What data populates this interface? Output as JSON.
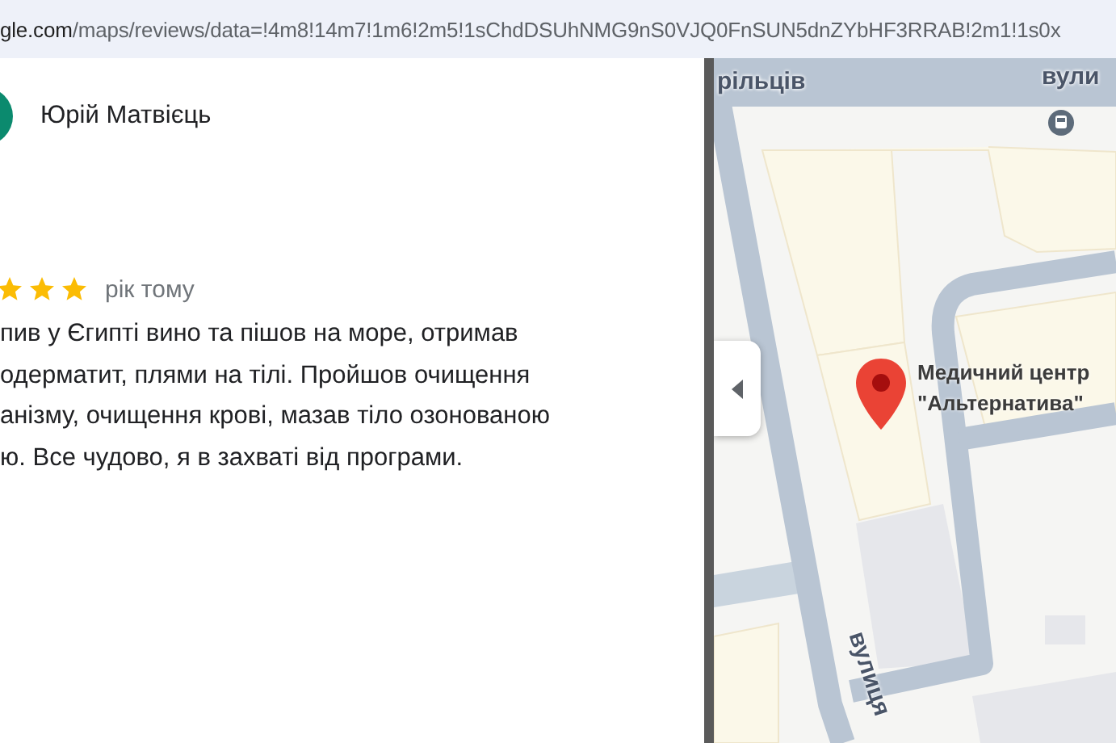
{
  "address_bar": {
    "url_host": "gle.com",
    "url_path": "/maps/reviews/data=!4m8!14m7!1m6!2m5!1sChdDSUhNMG9nS0VJQ0FnSUN5dnZYbHF3RRAB!2m1!1s0x"
  },
  "review": {
    "author": "Юрій Матвієць",
    "stars": 3,
    "time": "рік тому",
    "lines": [
      "пив у Єгипті вино та пішов на море, отримав",
      "одерматит, плями на тілі. Пройшов очищення",
      "анізму, очищення крові, мазав тіло озонованою",
      "ю. Все чудово, я в захваті від програми."
    ]
  },
  "map": {
    "streets": [
      "рільців",
      "вули",
      "вулиця"
    ],
    "place": {
      "name_lines": [
        "Медичний центр",
        "\"Альтернатива\""
      ]
    }
  }
}
